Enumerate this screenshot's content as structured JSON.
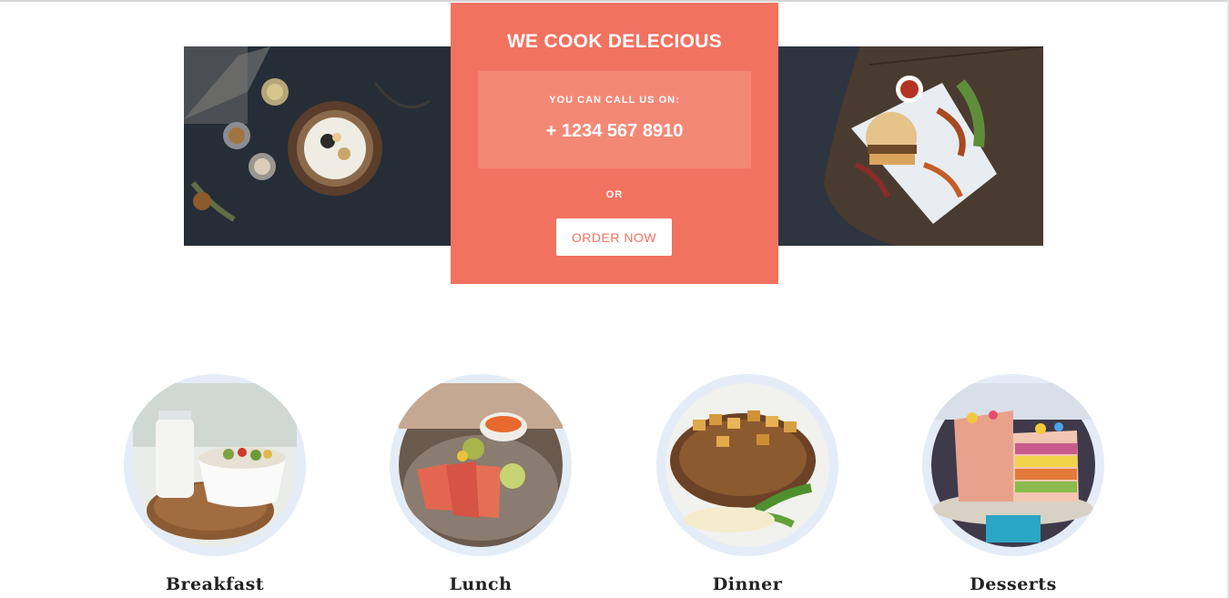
{
  "hero": {
    "title": "WE COOK DELECIOUS",
    "call_label": "YOU CAN CALL US ON:",
    "phone": "+ 1234 567 8910",
    "or_text": "OR",
    "order_button": "ORDER NOW",
    "colors": {
      "accent": "#f27260",
      "call_box": "#f48876",
      "button_text": "#f27260"
    }
  },
  "categories": [
    {
      "label": "Breakfast",
      "icon": "breakfast-bowl-photo"
    },
    {
      "label": "Lunch",
      "icon": "lunch-plate-photo"
    },
    {
      "label": "Dinner",
      "icon": "dinner-steak-photo"
    },
    {
      "label": "Desserts",
      "icon": "dessert-cake-photo"
    }
  ]
}
